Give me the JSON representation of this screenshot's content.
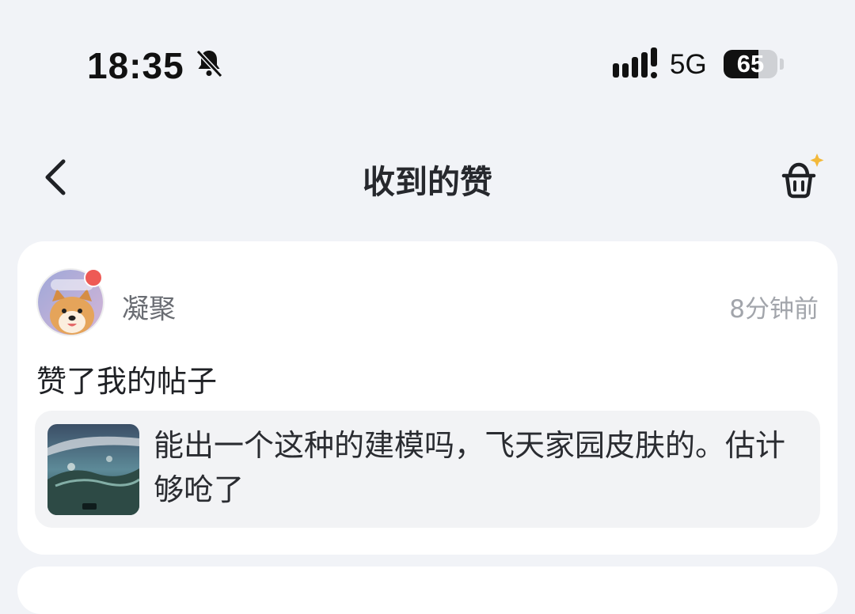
{
  "status_bar": {
    "time": "18:35",
    "network": "5G",
    "battery_level": "65",
    "battery_fraction": 0.65,
    "icons": [
      "bell-muted-icon",
      "signal-icon",
      "battery-icon"
    ]
  },
  "nav": {
    "title": "收到的赞",
    "back_icon": "chevron-left-icon",
    "clean_icon": "clear-basket-icon"
  },
  "notifications": [
    {
      "username": "凝聚",
      "time": "8分钟前",
      "action": "赞了我的帖子",
      "avatar_label": "狗哥哥",
      "unread": true,
      "post_text": "能出一个这种的建模吗，飞天家园皮肤的。估计够呛了"
    }
  ],
  "colors": {
    "background": "#f1f3f7",
    "card": "#ffffff",
    "unread_dot": "#ee5a55",
    "sparkle": "#f3b93a"
  }
}
